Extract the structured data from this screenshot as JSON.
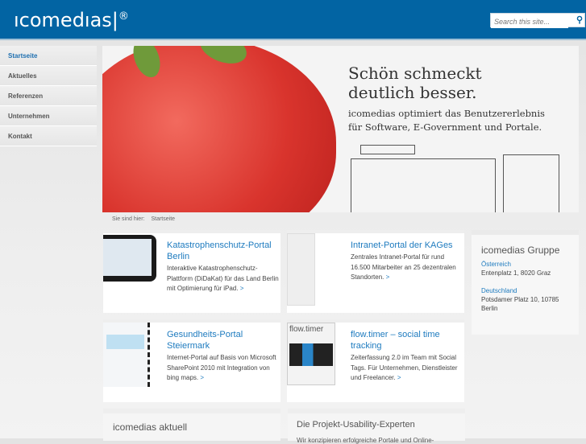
{
  "header": {
    "logo": "ıcomedıas|",
    "logo_mark": "®",
    "search_placeholder": "Search this site...",
    "search_icon": "search-icon"
  },
  "nav": [
    {
      "label": "Startseite",
      "active": true
    },
    {
      "label": "Aktuelles"
    },
    {
      "label": "Referenzen"
    },
    {
      "label": "Unternehmen"
    },
    {
      "label": "Kontakt"
    }
  ],
  "hero": {
    "headline1": "Schön schmeckt",
    "headline2": "deutlich besser.",
    "sub1": "icomedias optimiert das Benutzererlebnis",
    "sub2": "für Software, E-Government und Portale."
  },
  "breadcrumb": {
    "label": "Sie sind hier:",
    "current": "Startseite"
  },
  "cards": [
    {
      "title": "Katastrophenschutz-Portal Berlin",
      "text": "Interaktive Katastrophenschutz-Plattform (DiDaKat) für das Land Berlin mit Optimierung für iPad.",
      "more": ">"
    },
    {
      "title": "Intranet-Portal der KAGes",
      "text": "Zentrales Intranet-Portal für rund 16.500 Mitarbeiter an 25 dezentralen Standorten.",
      "more": ">"
    },
    {
      "title": "Gesundheits-Portal Steiermark",
      "text": "Internet-Portal auf Basis von Microsoft SharePoint 2010 mit Integration von bing maps.",
      "more": ">"
    },
    {
      "title": "flow.timer – social time tracking",
      "text": "Zeiterfassung 2.0 im Team mit Social Tags. Für Unternehmen, Dienstleister und Freelancer.",
      "more": ">"
    }
  ],
  "group": {
    "title": "icomedias Gruppe",
    "locations": [
      {
        "country": "Österreich",
        "address": "Entenplatz 1, 8020 Graz"
      },
      {
        "country": "Deutschland",
        "address": "Potsdamer Platz 10, 10785 Berlin"
      }
    ]
  },
  "news": {
    "title": "icomedias aktuell"
  },
  "experts": {
    "title": "Die Projekt-Usability-Experten",
    "text": "Wir konzipieren erfolgreiche Portale und Online-"
  },
  "flowtimer_logo": "flow.timer"
}
